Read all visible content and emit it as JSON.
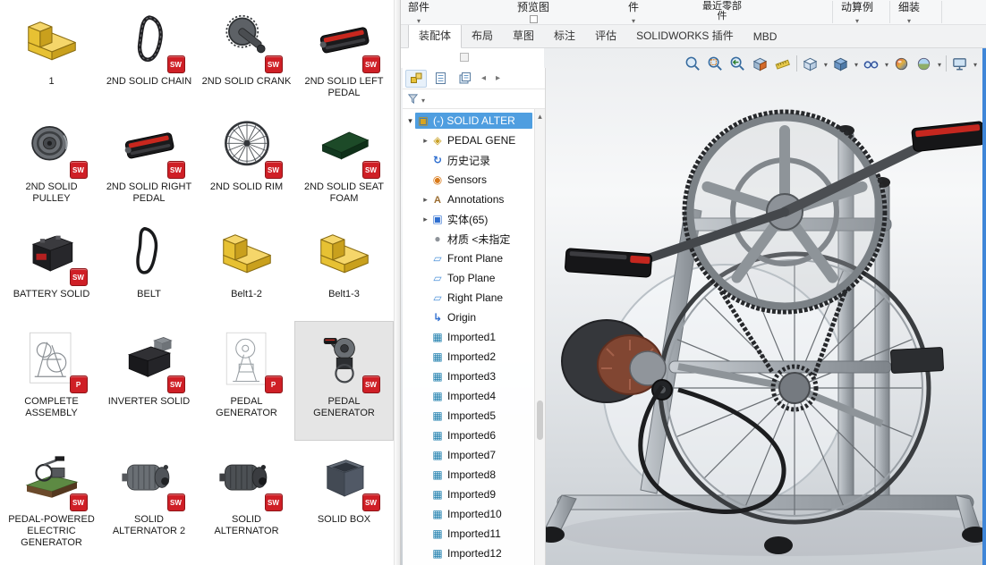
{
  "colors": {
    "selection_blue": "#4f9ee0",
    "badge_red": "#cf1f26",
    "window_edge_blue": "#3f86d8",
    "viewport_gradient_top": "#eceef0",
    "viewport_gradient_bottom": "#c8cdd2"
  },
  "file_panel": {
    "items": [
      {
        "label": "1",
        "badge": "",
        "selected": false
      },
      {
        "label": "2ND SOLID CHAIN",
        "badge": "SW",
        "selected": false
      },
      {
        "label": "2ND SOLID CRANK",
        "badge": "SW",
        "selected": false
      },
      {
        "label": "2ND SOLID LEFT PEDAL",
        "badge": "SW",
        "selected": false
      },
      {
        "label": "2ND SOLID PULLEY",
        "badge": "SW",
        "selected": false
      },
      {
        "label": "2ND SOLID RIGHT PEDAL",
        "badge": "SW",
        "selected": false
      },
      {
        "label": "2ND SOLID RIM",
        "badge": "SW",
        "selected": false
      },
      {
        "label": "2ND SOLID SEAT FOAM",
        "badge": "SW",
        "selected": false
      },
      {
        "label": "BATTERY SOLID",
        "badge": "SW",
        "selected": false
      },
      {
        "label": "BELT",
        "badge": "",
        "selected": false
      },
      {
        "label": "Belt1-2",
        "badge": "",
        "selected": false
      },
      {
        "label": "Belt1-3",
        "badge": "",
        "selected": false
      },
      {
        "label": "COMPLETE ASSEMBLY",
        "badge": "P",
        "selected": false
      },
      {
        "label": "INVERTER SOLID",
        "badge": "SW",
        "selected": false
      },
      {
        "label": "PEDAL GENERATOR",
        "badge": "P",
        "selected": false
      },
      {
        "label": "PEDAL GENERATOR",
        "badge": "SW",
        "selected": true
      },
      {
        "label": "PEDAL-POWERED ELECTRIC GENERATOR",
        "badge": "SW",
        "selected": false
      },
      {
        "label": "SOLID ALTERNATOR 2",
        "badge": "SW",
        "selected": false
      },
      {
        "label": "SOLID ALTERNATOR",
        "badge": "SW",
        "selected": false
      },
      {
        "label": "SOLID BOX",
        "badge": "SW",
        "selected": false
      }
    ]
  },
  "ribbon": {
    "items": [
      "部件",
      "预览图",
      "件",
      "最近零部件",
      "动算例",
      "细装"
    ],
    "tabs": [
      {
        "label": "装配体",
        "active": true
      },
      {
        "label": "布局",
        "active": false
      },
      {
        "label": "草图",
        "active": false
      },
      {
        "label": "标注",
        "active": false
      },
      {
        "label": "评估",
        "active": false
      },
      {
        "label": "SOLIDWORKS 插件",
        "active": false
      },
      {
        "label": "MBD",
        "active": false
      }
    ]
  },
  "hud": {
    "icons": [
      "zoom-to-fit",
      "zoom-to-area",
      "previous-view",
      "section-view",
      "measure",
      "view-orientation",
      "display-style",
      "hide-show-items",
      "edit-appearance",
      "apply-scene",
      "view-settings"
    ]
  },
  "feature_tree": {
    "tabs": [
      "featuremanager",
      "displaymanager",
      "configurationmanager"
    ],
    "items": [
      {
        "label": "(-) SOLID ALTER",
        "icon": "assembly",
        "selected": true,
        "expanded": true
      },
      {
        "label": "PEDAL GENE",
        "icon": "part",
        "expandable": true
      },
      {
        "label": "历史记录",
        "icon": "history"
      },
      {
        "label": "Sensors",
        "icon": "sensors"
      },
      {
        "label": "Annotations",
        "icon": "annotations",
        "expandable": true
      },
      {
        "label": "实体(65)",
        "icon": "solid-bodies",
        "expandable": true
      },
      {
        "label": "材质 <未指定",
        "icon": "material"
      },
      {
        "label": "Front Plane",
        "icon": "plane"
      },
      {
        "label": "Top Plane",
        "icon": "plane"
      },
      {
        "label": "Right Plane",
        "icon": "plane"
      },
      {
        "label": "Origin",
        "icon": "origin"
      },
      {
        "label": "Imported1",
        "icon": "imported"
      },
      {
        "label": "Imported2",
        "icon": "imported"
      },
      {
        "label": "Imported3",
        "icon": "imported"
      },
      {
        "label": "Imported4",
        "icon": "imported"
      },
      {
        "label": "Imported5",
        "icon": "imported"
      },
      {
        "label": "Imported6",
        "icon": "imported"
      },
      {
        "label": "Imported7",
        "icon": "imported"
      },
      {
        "label": "Imported8",
        "icon": "imported"
      },
      {
        "label": "Imported9",
        "icon": "imported"
      },
      {
        "label": "Imported10",
        "icon": "imported"
      },
      {
        "label": "Imported11",
        "icon": "imported"
      },
      {
        "label": "Imported12",
        "icon": "imported"
      }
    ]
  }
}
